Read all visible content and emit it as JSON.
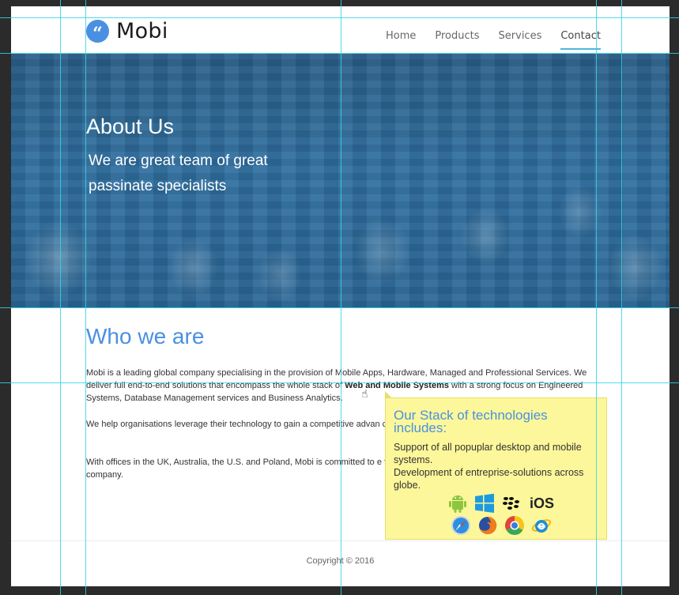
{
  "brand": {
    "name": "Mobi",
    "logo_glyph": "“"
  },
  "nav": {
    "items": [
      "Home",
      "Products",
      "Services",
      "Contact"
    ],
    "active": "Contact"
  },
  "hero": {
    "title": "About Us",
    "subtitle": "We are great team of great passinate specialists"
  },
  "content": {
    "title": "Who we are",
    "p1_before": "Mobi is a leading global company specialising in the provision of Mobile Apps, Hardware, Managed and Professional Services. We deliver full end-to-end solutions that encompass the whole stack of ",
    "p1_bold": "Web and Mobile Systems",
    "p1_after": " with a strong focus on Engineered Systems, Database Management services and Business Analytics.",
    "p2": "We help organisations leverage their technology to gain a competitive advan changing demands of a competitive market place.",
    "p3": "With offices in the UK, Australia, the U.S. and Poland, Mobi is committed to e from their investments into partnership with our company."
  },
  "tooltip": {
    "title": "Our Stack of technologies includes:",
    "line1": "Support of all popuplar desktop and mobile systems.",
    "line2": "Development of entreprise-solutions across globe.",
    "ios_label": "iOS",
    "icons_row1": [
      "android-icon",
      "windows-icon",
      "blackberry-icon",
      "ios-icon"
    ],
    "icons_row2": [
      "safari-icon",
      "firefox-icon",
      "chrome-icon",
      "internet-explorer-icon"
    ]
  },
  "footer": {
    "copyright": "Copyright © 2016"
  },
  "colors": {
    "accent": "#4a90e2",
    "hero_overlay": "#2f6fa0",
    "tooltip_bg": "#fcf79a",
    "guide": "#30d6e6"
  }
}
